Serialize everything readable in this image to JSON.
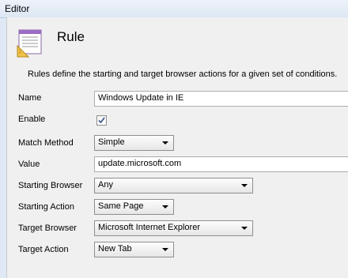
{
  "window": {
    "title": "Editor"
  },
  "header": {
    "icon": "rule-document-icon",
    "title": "Rule"
  },
  "description": "Rules define the starting and target browser actions for a given set of conditions.",
  "form": {
    "name": {
      "label": "Name",
      "value": "Windows Update in IE"
    },
    "enable": {
      "label": "Enable",
      "checked": true
    },
    "match_method": {
      "label": "Match Method",
      "selected": "Simple"
    },
    "value": {
      "label": "Value",
      "value": "update.microsoft.com"
    },
    "starting_browser": {
      "label": "Starting Browser",
      "selected": "Any"
    },
    "starting_action": {
      "label": "Starting Action",
      "selected": "Same Page"
    },
    "target_browser": {
      "label": "Target Browser",
      "selected": "Microsoft Internet Explorer"
    },
    "target_action": {
      "label": "Target Action",
      "selected": "New Tab"
    }
  }
}
